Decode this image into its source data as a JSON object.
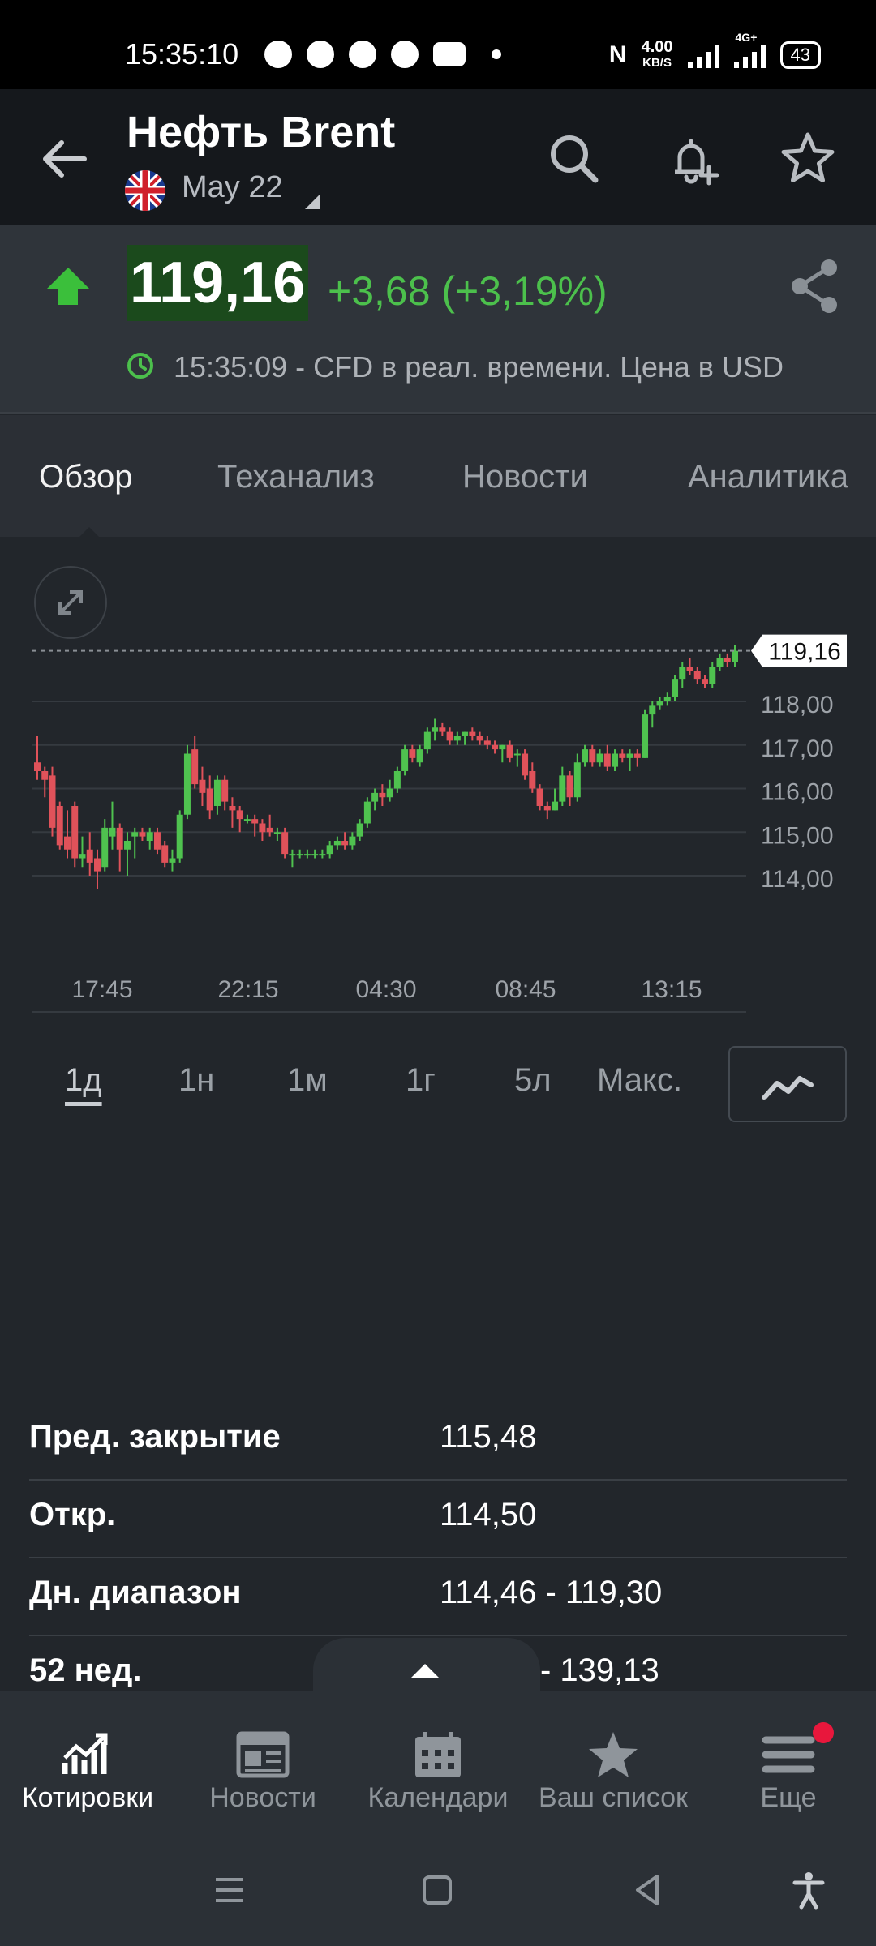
{
  "status_bar": {
    "time": "15:35:10",
    "speed_value": "4.00",
    "speed_unit": "KB/S",
    "network": "4G+",
    "battery": "43"
  },
  "header": {
    "title": "Нефть Brent",
    "subtitle": "May 22"
  },
  "quote": {
    "price": "119,16",
    "change": "+3,68 (+3,19%)",
    "time_note": "15:35:09 - CFD в реал. времени. Цена в USD",
    "up_color": "#4cc04c"
  },
  "tabs": [
    "Обзор",
    "Теханализ",
    "Новости",
    "Аналитика"
  ],
  "chart": {
    "current_price_label": "119,16",
    "y_ticks": [
      "118,00",
      "117,00",
      "116,00",
      "115,00",
      "114,00"
    ],
    "x_ticks": [
      "17:45",
      "22:15",
      "04:30",
      "08:45",
      "13:15"
    ]
  },
  "chart_data": {
    "type": "candlestick",
    "x": [
      "17:45",
      "22:15",
      "04:30",
      "08:45",
      "13:15"
    ],
    "ylim": [
      113.7,
      119.8
    ],
    "last": 119.16,
    "up_color": "#4fc24f",
    "down_color": "#e0525a",
    "candles": [
      {
        "o": 116.6,
        "h": 117.2,
        "l": 116.2,
        "c": 116.4
      },
      {
        "o": 116.4,
        "h": 116.5,
        "l": 115.8,
        "c": 116.2
      },
      {
        "o": 116.3,
        "h": 116.5,
        "l": 114.9,
        "c": 115.1
      },
      {
        "o": 115.6,
        "h": 115.7,
        "l": 114.6,
        "c": 114.7
      },
      {
        "o": 114.9,
        "h": 115.5,
        "l": 114.4,
        "c": 114.6
      },
      {
        "o": 115.6,
        "h": 115.7,
        "l": 114.2,
        "c": 114.4
      },
      {
        "o": 114.4,
        "h": 114.9,
        "l": 114.2,
        "c": 114.5
      },
      {
        "o": 114.6,
        "h": 115.0,
        "l": 114.0,
        "c": 114.3
      },
      {
        "o": 114.4,
        "h": 114.6,
        "l": 113.7,
        "c": 114.1
      },
      {
        "o": 114.2,
        "h": 115.3,
        "l": 114.1,
        "c": 115.1
      },
      {
        "o": 114.9,
        "h": 115.7,
        "l": 114.6,
        "c": 115.1
      },
      {
        "o": 115.1,
        "h": 115.2,
        "l": 114.1,
        "c": 114.6
      },
      {
        "o": 114.6,
        "h": 115.0,
        "l": 114.0,
        "c": 114.8
      },
      {
        "o": 114.9,
        "h": 115.1,
        "l": 114.4,
        "c": 115.0
      },
      {
        "o": 115.0,
        "h": 115.1,
        "l": 114.8,
        "c": 114.9
      },
      {
        "o": 114.8,
        "h": 115.1,
        "l": 114.6,
        "c": 115.0
      },
      {
        "o": 115.0,
        "h": 115.1,
        "l": 114.5,
        "c": 114.6
      },
      {
        "o": 114.7,
        "h": 114.8,
        "l": 114.2,
        "c": 114.3
      },
      {
        "o": 114.3,
        "h": 114.6,
        "l": 114.1,
        "c": 114.4
      },
      {
        "o": 114.4,
        "h": 115.5,
        "l": 114.3,
        "c": 115.4
      },
      {
        "o": 115.4,
        "h": 117.0,
        "l": 115.3,
        "c": 116.8
      },
      {
        "o": 116.9,
        "h": 117.2,
        "l": 116.0,
        "c": 116.1
      },
      {
        "o": 116.2,
        "h": 116.5,
        "l": 115.6,
        "c": 115.9
      },
      {
        "o": 116.0,
        "h": 116.3,
        "l": 115.3,
        "c": 115.5
      },
      {
        "o": 115.6,
        "h": 116.3,
        "l": 115.4,
        "c": 116.2
      },
      {
        "o": 116.2,
        "h": 116.3,
        "l": 115.5,
        "c": 115.7
      },
      {
        "o": 115.6,
        "h": 115.8,
        "l": 115.1,
        "c": 115.5
      },
      {
        "o": 115.5,
        "h": 115.6,
        "l": 115.0,
        "c": 115.3
      },
      {
        "o": 115.3,
        "h": 115.4,
        "l": 115.2,
        "c": 115.3
      },
      {
        "o": 115.3,
        "h": 115.4,
        "l": 114.9,
        "c": 115.2
      },
      {
        "o": 115.2,
        "h": 115.3,
        "l": 114.8,
        "c": 115.0
      },
      {
        "o": 115.1,
        "h": 115.4,
        "l": 114.9,
        "c": 115.0
      },
      {
        "o": 115.0,
        "h": 115.1,
        "l": 114.8,
        "c": 115.0
      },
      {
        "o": 115.0,
        "h": 115.1,
        "l": 114.4,
        "c": 114.5
      },
      {
        "o": 114.5,
        "h": 114.6,
        "l": 114.2,
        "c": 114.5
      },
      {
        "o": 114.5,
        "h": 114.6,
        "l": 114.4,
        "c": 114.5
      },
      {
        "o": 114.5,
        "h": 114.6,
        "l": 114.4,
        "c": 114.5
      },
      {
        "o": 114.5,
        "h": 114.6,
        "l": 114.4,
        "c": 114.5
      },
      {
        "o": 114.5,
        "h": 114.6,
        "l": 114.4,
        "c": 114.5
      },
      {
        "o": 114.5,
        "h": 114.8,
        "l": 114.4,
        "c": 114.7
      },
      {
        "o": 114.7,
        "h": 114.9,
        "l": 114.6,
        "c": 114.8
      },
      {
        "o": 114.8,
        "h": 115.0,
        "l": 114.6,
        "c": 114.7
      },
      {
        "o": 114.7,
        "h": 115.0,
        "l": 114.6,
        "c": 114.9
      },
      {
        "o": 114.9,
        "h": 115.3,
        "l": 114.8,
        "c": 115.2
      },
      {
        "o": 115.2,
        "h": 115.8,
        "l": 115.1,
        "c": 115.7
      },
      {
        "o": 115.7,
        "h": 116.0,
        "l": 115.5,
        "c": 115.9
      },
      {
        "o": 115.9,
        "h": 116.1,
        "l": 115.6,
        "c": 115.8
      },
      {
        "o": 115.8,
        "h": 116.2,
        "l": 115.7,
        "c": 116.0
      },
      {
        "o": 116.0,
        "h": 116.5,
        "l": 115.9,
        "c": 116.4
      },
      {
        "o": 116.4,
        "h": 117.0,
        "l": 116.3,
        "c": 116.9
      },
      {
        "o": 116.9,
        "h": 117.0,
        "l": 116.6,
        "c": 116.7
      },
      {
        "o": 116.6,
        "h": 117.0,
        "l": 116.5,
        "c": 116.9
      },
      {
        "o": 116.9,
        "h": 117.4,
        "l": 116.8,
        "c": 117.3
      },
      {
        "o": 117.3,
        "h": 117.6,
        "l": 117.1,
        "c": 117.4
      },
      {
        "o": 117.4,
        "h": 117.5,
        "l": 117.2,
        "c": 117.3
      },
      {
        "o": 117.3,
        "h": 117.4,
        "l": 117.0,
        "c": 117.1
      },
      {
        "o": 117.1,
        "h": 117.3,
        "l": 117.0,
        "c": 117.2
      },
      {
        "o": 117.2,
        "h": 117.3,
        "l": 117.0,
        "c": 117.3
      },
      {
        "o": 117.3,
        "h": 117.4,
        "l": 117.1,
        "c": 117.2
      },
      {
        "o": 117.2,
        "h": 117.3,
        "l": 117.0,
        "c": 117.1
      },
      {
        "o": 117.1,
        "h": 117.2,
        "l": 116.9,
        "c": 117.0
      },
      {
        "o": 117.0,
        "h": 117.1,
        "l": 116.8,
        "c": 116.9
      },
      {
        "o": 116.9,
        "h": 117.0,
        "l": 116.6,
        "c": 117.0
      },
      {
        "o": 117.0,
        "h": 117.1,
        "l": 116.6,
        "c": 116.7
      },
      {
        "o": 116.8,
        "h": 116.9,
        "l": 116.5,
        "c": 116.8
      },
      {
        "o": 116.8,
        "h": 116.9,
        "l": 116.2,
        "c": 116.3
      },
      {
        "o": 116.4,
        "h": 116.6,
        "l": 115.9,
        "c": 116.0
      },
      {
        "o": 116.0,
        "h": 116.1,
        "l": 115.5,
        "c": 115.6
      },
      {
        "o": 115.6,
        "h": 115.7,
        "l": 115.3,
        "c": 115.5
      },
      {
        "o": 115.5,
        "h": 116.0,
        "l": 115.5,
        "c": 115.7
      },
      {
        "o": 115.7,
        "h": 116.5,
        "l": 115.6,
        "c": 116.3
      },
      {
        "o": 116.3,
        "h": 116.4,
        "l": 115.6,
        "c": 115.8
      },
      {
        "o": 115.8,
        "h": 116.8,
        "l": 115.7,
        "c": 116.6
      },
      {
        "o": 116.6,
        "h": 117.0,
        "l": 116.5,
        "c": 116.9
      },
      {
        "o": 116.9,
        "h": 117.0,
        "l": 116.5,
        "c": 116.6
      },
      {
        "o": 116.6,
        "h": 116.9,
        "l": 116.5,
        "c": 116.8
      },
      {
        "o": 116.8,
        "h": 117.0,
        "l": 116.4,
        "c": 116.5
      },
      {
        "o": 116.5,
        "h": 116.9,
        "l": 116.4,
        "c": 116.8
      },
      {
        "o": 116.8,
        "h": 116.9,
        "l": 116.6,
        "c": 116.7
      },
      {
        "o": 116.7,
        "h": 116.9,
        "l": 116.4,
        "c": 116.8
      },
      {
        "o": 116.8,
        "h": 116.9,
        "l": 116.5,
        "c": 116.7
      },
      {
        "o": 116.7,
        "h": 117.8,
        "l": 116.7,
        "c": 117.7
      },
      {
        "o": 117.7,
        "h": 118.0,
        "l": 117.4,
        "c": 117.9
      },
      {
        "o": 117.9,
        "h": 118.1,
        "l": 117.8,
        "c": 118.0
      },
      {
        "o": 118.0,
        "h": 118.2,
        "l": 117.9,
        "c": 118.1
      },
      {
        "o": 118.1,
        "h": 118.6,
        "l": 118.0,
        "c": 118.5
      },
      {
        "o": 118.5,
        "h": 118.9,
        "l": 118.3,
        "c": 118.8
      },
      {
        "o": 118.8,
        "h": 119.0,
        "l": 118.6,
        "c": 118.7
      },
      {
        "o": 118.7,
        "h": 118.8,
        "l": 118.4,
        "c": 118.5
      },
      {
        "o": 118.5,
        "h": 118.6,
        "l": 118.3,
        "c": 118.4
      },
      {
        "o": 118.4,
        "h": 118.9,
        "l": 118.3,
        "c": 118.8
      },
      {
        "o": 118.8,
        "h": 119.1,
        "l": 118.7,
        "c": 119.0
      },
      {
        "o": 119.0,
        "h": 119.1,
        "l": 118.8,
        "c": 118.9
      },
      {
        "o": 118.9,
        "h": 119.3,
        "l": 118.8,
        "c": 119.16
      }
    ]
  },
  "time_ranges": [
    "1д",
    "1н",
    "1м",
    "1г",
    "5л",
    "Макс."
  ],
  "stats": [
    {
      "label": "Пред. закрытие",
      "value": "115,48"
    },
    {
      "label": "Откр.",
      "value": "114,50"
    },
    {
      "label": "Дн. диапазон",
      "value": "114,46 - 119,30"
    },
    {
      "label": "52 нед.",
      "value": "- 139,13"
    }
  ],
  "bottom_nav": [
    {
      "label": "Котировки",
      "icon": "chart-icon"
    },
    {
      "label": "Новости",
      "icon": "newspaper-icon"
    },
    {
      "label": "Календари",
      "icon": "calendar-icon"
    },
    {
      "label": "Ваш список",
      "icon": "star-icon"
    },
    {
      "label": "Еще",
      "icon": "menu-icon"
    }
  ]
}
